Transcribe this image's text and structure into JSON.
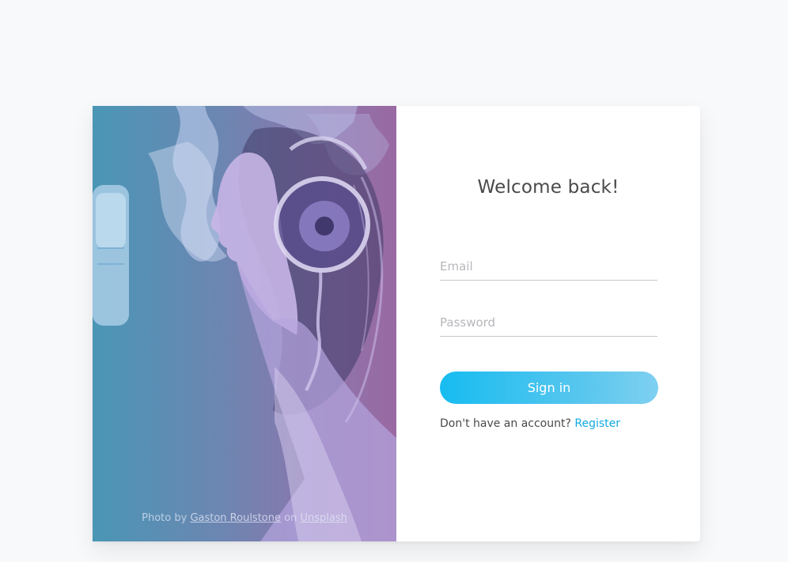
{
  "login": {
    "title": "Welcome back!",
    "email_placeholder": "Email",
    "password_placeholder": "Password",
    "signin_label": "Sign in",
    "no_account_text": "Don't have an account?",
    "register_label": "Register"
  },
  "photo": {
    "credit_prefix": "Photo by",
    "author": "Gaston Roulstone",
    "credit_middle": "on",
    "source": "Unsplash"
  },
  "colors": {
    "background": "#f8f9fb",
    "accent": "#12a9e0",
    "button_start": "#17bcf0",
    "gradient_left": "#4a96b5",
    "gradient_right": "#9a69a2"
  }
}
